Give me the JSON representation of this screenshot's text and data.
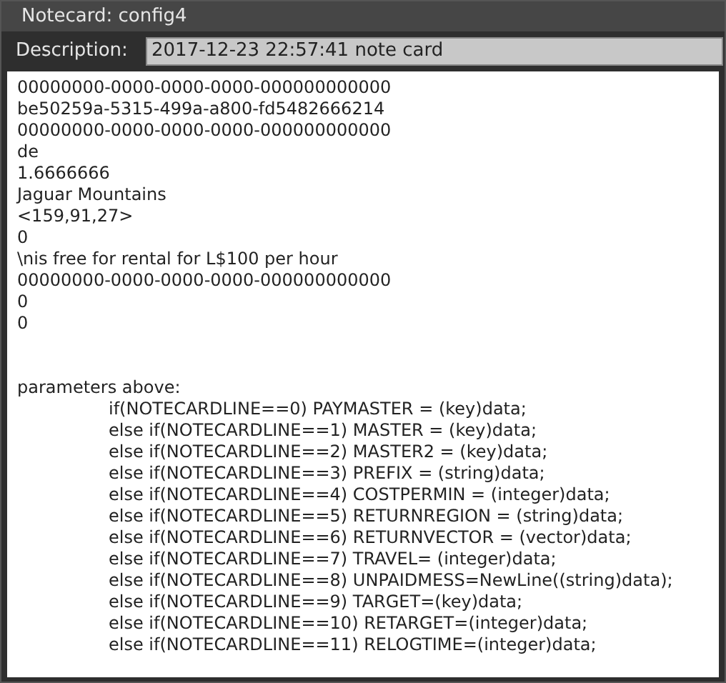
{
  "window": {
    "title": "Notecard: config4"
  },
  "description": {
    "label": "Description:",
    "value": "2017-12-23 22:57:41 note card"
  },
  "values": [
    "00000000-0000-0000-0000-000000000000",
    "be50259a-5315-499a-a800-fd5482666214",
    "00000000-0000-0000-0000-000000000000",
    "de",
    "1.6666666",
    "Jaguar Mountains",
    "<159,91,27>",
    "0",
    "\\nis free for rental for L$100 per hour",
    "00000000-0000-0000-0000-000000000000",
    "0",
    "0"
  ],
  "parameters": {
    "heading": "parameters above:",
    "code_lines": [
      "if(NOTECARDLINE==0) PAYMASTER = (key)data;",
      "else if(NOTECARDLINE==1) MASTER = (key)data;",
      "else if(NOTECARDLINE==2) MASTER2 = (key)data;",
      "else if(NOTECARDLINE==3) PREFIX = (string)data;",
      "else if(NOTECARDLINE==4) COSTPERMIN = (integer)data;",
      "else if(NOTECARDLINE==5) RETURNREGION = (string)data;",
      "else if(NOTECARDLINE==6) RETURNVECTOR = (vector)data;",
      "else if(NOTECARDLINE==7) TRAVEL= (integer)data;",
      "else if(NOTECARDLINE==8) UNPAIDMESS=NewLine((string)data);",
      "else if(NOTECARDLINE==9) TARGET=(key)data;",
      "else if(NOTECARDLINE==10) RETARGET=(integer)data;",
      "else if(NOTECARDLINE==11) RELOGTIME=(integer)data;"
    ]
  }
}
